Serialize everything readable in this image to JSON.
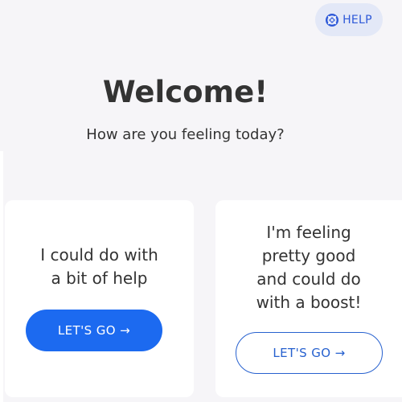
{
  "header": {
    "help_label": "HELP",
    "help_icon": "lifebuoy-icon"
  },
  "welcome": {
    "title": "Welcome!",
    "subtitle": "How are you feeling today?"
  },
  "cards": [
    {
      "lines": [
        "I could do with",
        "a bit of help"
      ],
      "button_label": "LET'S GO →"
    },
    {
      "lines": [
        "I'm feeling",
        "pretty good",
        "and could do",
        "with a boost!"
      ],
      "button_label": "LET'S GO →"
    }
  ],
  "colors": {
    "accent": "#1c6af0",
    "help_background": "#e3e8f7",
    "page_background": "#f6f5f8"
  }
}
